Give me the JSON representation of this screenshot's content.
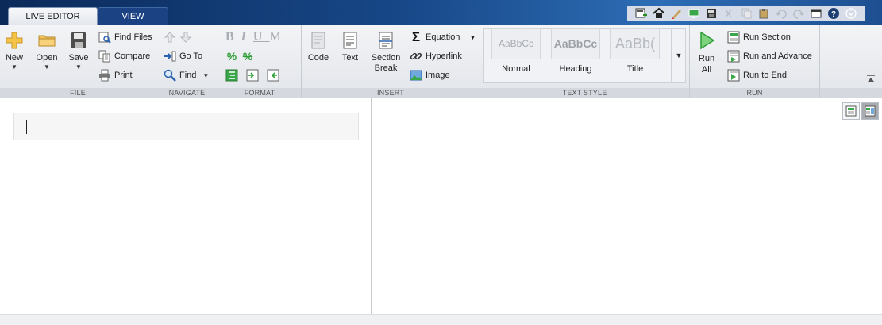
{
  "tabs": {
    "live_editor": "LIVE EDITOR",
    "view": "VIEW"
  },
  "file": {
    "label": "FILE",
    "new": "New",
    "open": "Open",
    "save": "Save",
    "find_files": "Find Files",
    "compare": "Compare",
    "print": "Print"
  },
  "navigate": {
    "label": "NAVIGATE",
    "go_to": "Go To",
    "find": "Find"
  },
  "format": {
    "label": "FORMAT",
    "bold": "B",
    "italic": "I",
    "underline": "U",
    "mono": "M"
  },
  "insert": {
    "label": "INSERT",
    "code": "Code",
    "text": "Text",
    "section_break_1": "Section",
    "section_break_2": "Break",
    "equation": "Equation",
    "hyperlink": "Hyperlink",
    "image": "Image"
  },
  "text_style": {
    "label": "TEXT STYLE",
    "normal_preview": "AaBbCc",
    "normal": "Normal",
    "heading_preview": "AaBbCc",
    "heading": "Heading",
    "title_preview": "AaBb(",
    "title": "Title"
  },
  "run": {
    "label": "RUN",
    "run_all_1": "Run",
    "run_all_2": "All",
    "run_section": "Run Section",
    "run_and_advance": "Run and Advance",
    "run_to_end": "Run to End"
  },
  "colors": {
    "ribbon_bg": "#e8eaee",
    "tab_strip": "#174787",
    "run_green": "#2f9e37"
  }
}
